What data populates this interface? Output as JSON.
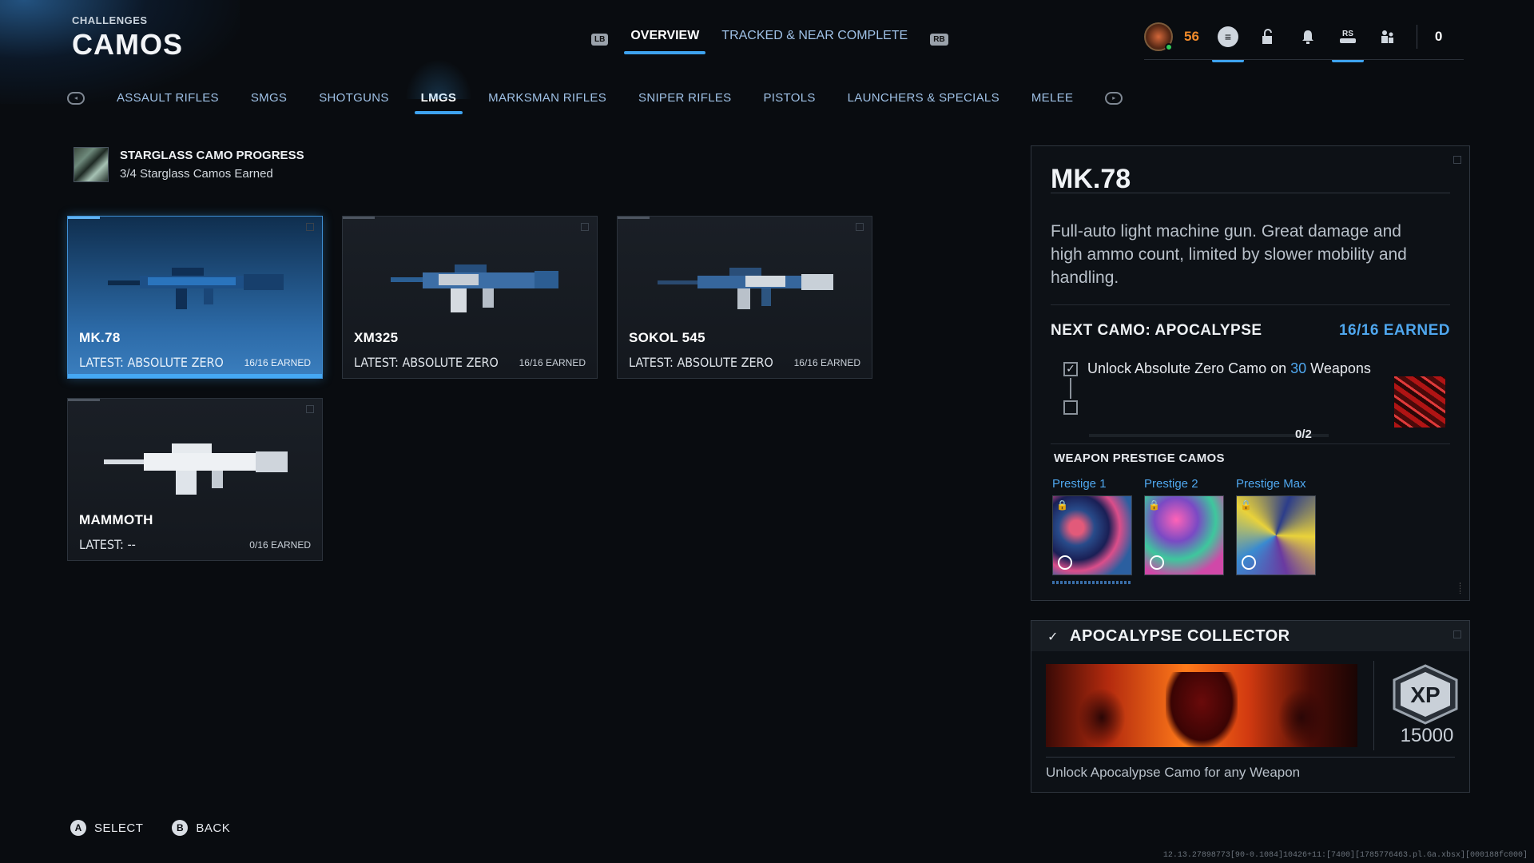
{
  "header": {
    "subtitle": "CHALLENGES",
    "title": "CAMOS"
  },
  "top_tabs": {
    "left_bumper": "LB",
    "right_bumper": "RB",
    "items": [
      {
        "label": "OVERVIEW",
        "active": true
      },
      {
        "label": "TRACKED & NEAR COMPLETE",
        "active": false
      }
    ]
  },
  "top_right": {
    "level": "56",
    "rs_label": "RS",
    "count": "0"
  },
  "categories": [
    {
      "label": "ASSAULT RIFLES"
    },
    {
      "label": "SMGS"
    },
    {
      "label": "SHOTGUNS"
    },
    {
      "label": "LMGS",
      "active": true
    },
    {
      "label": "MARKSMAN RIFLES"
    },
    {
      "label": "SNIPER RIFLES"
    },
    {
      "label": "PISTOLS"
    },
    {
      "label": "LAUNCHERS & SPECIALS"
    },
    {
      "label": "MELEE"
    }
  ],
  "progress": {
    "title": "STARGLASS CAMO PROGRESS",
    "subtitle": "3/4 Starglass Camos Earned"
  },
  "weapons": [
    {
      "name": "MK.78",
      "latest": "LATEST: ABSOLUTE ZERO",
      "earned": "16/16 EARNED",
      "selected": true
    },
    {
      "name": "XM325",
      "latest": "LATEST: ABSOLUTE ZERO",
      "earned": "16/16 EARNED"
    },
    {
      "name": "SOKOL 545",
      "latest": "LATEST: ABSOLUTE ZERO",
      "earned": "16/16 EARNED"
    },
    {
      "name": "MAMMOTH",
      "latest": "LATEST: --",
      "earned": "0/16 EARNED"
    }
  ],
  "detail": {
    "title": "MK.78",
    "description": "Full-auto light machine gun. Great damage and high ammo count, limited by slower mobility and handling.",
    "next_camo": "NEXT CAMO: APOCALYPSE",
    "next_earned": "16/16 EARNED",
    "task_prefix": "Unlock Absolute Zero Camo on ",
    "task_count": "30",
    "task_suffix": " Weapons",
    "task_progress": "0/2",
    "prestige_title": "WEAPON PRESTIGE CAMOS",
    "prestige": [
      {
        "label": "Prestige 1"
      },
      {
        "label": "Prestige 2"
      },
      {
        "label": "Prestige Max"
      }
    ]
  },
  "collector": {
    "title": "APOCALYPSE COLLECTOR",
    "xp_label": "XP",
    "xp_value": "15000",
    "description": "Unlock Apocalypse Camo for any Weapon"
  },
  "prompts": [
    {
      "button": "A",
      "label": "SELECT"
    },
    {
      "button": "B",
      "label": "BACK"
    }
  ],
  "build_id": "12.13.27898773[90-0.1084]10426+11:[7400][1785776463.pl.Ga.xbsx][000188fc000]"
}
